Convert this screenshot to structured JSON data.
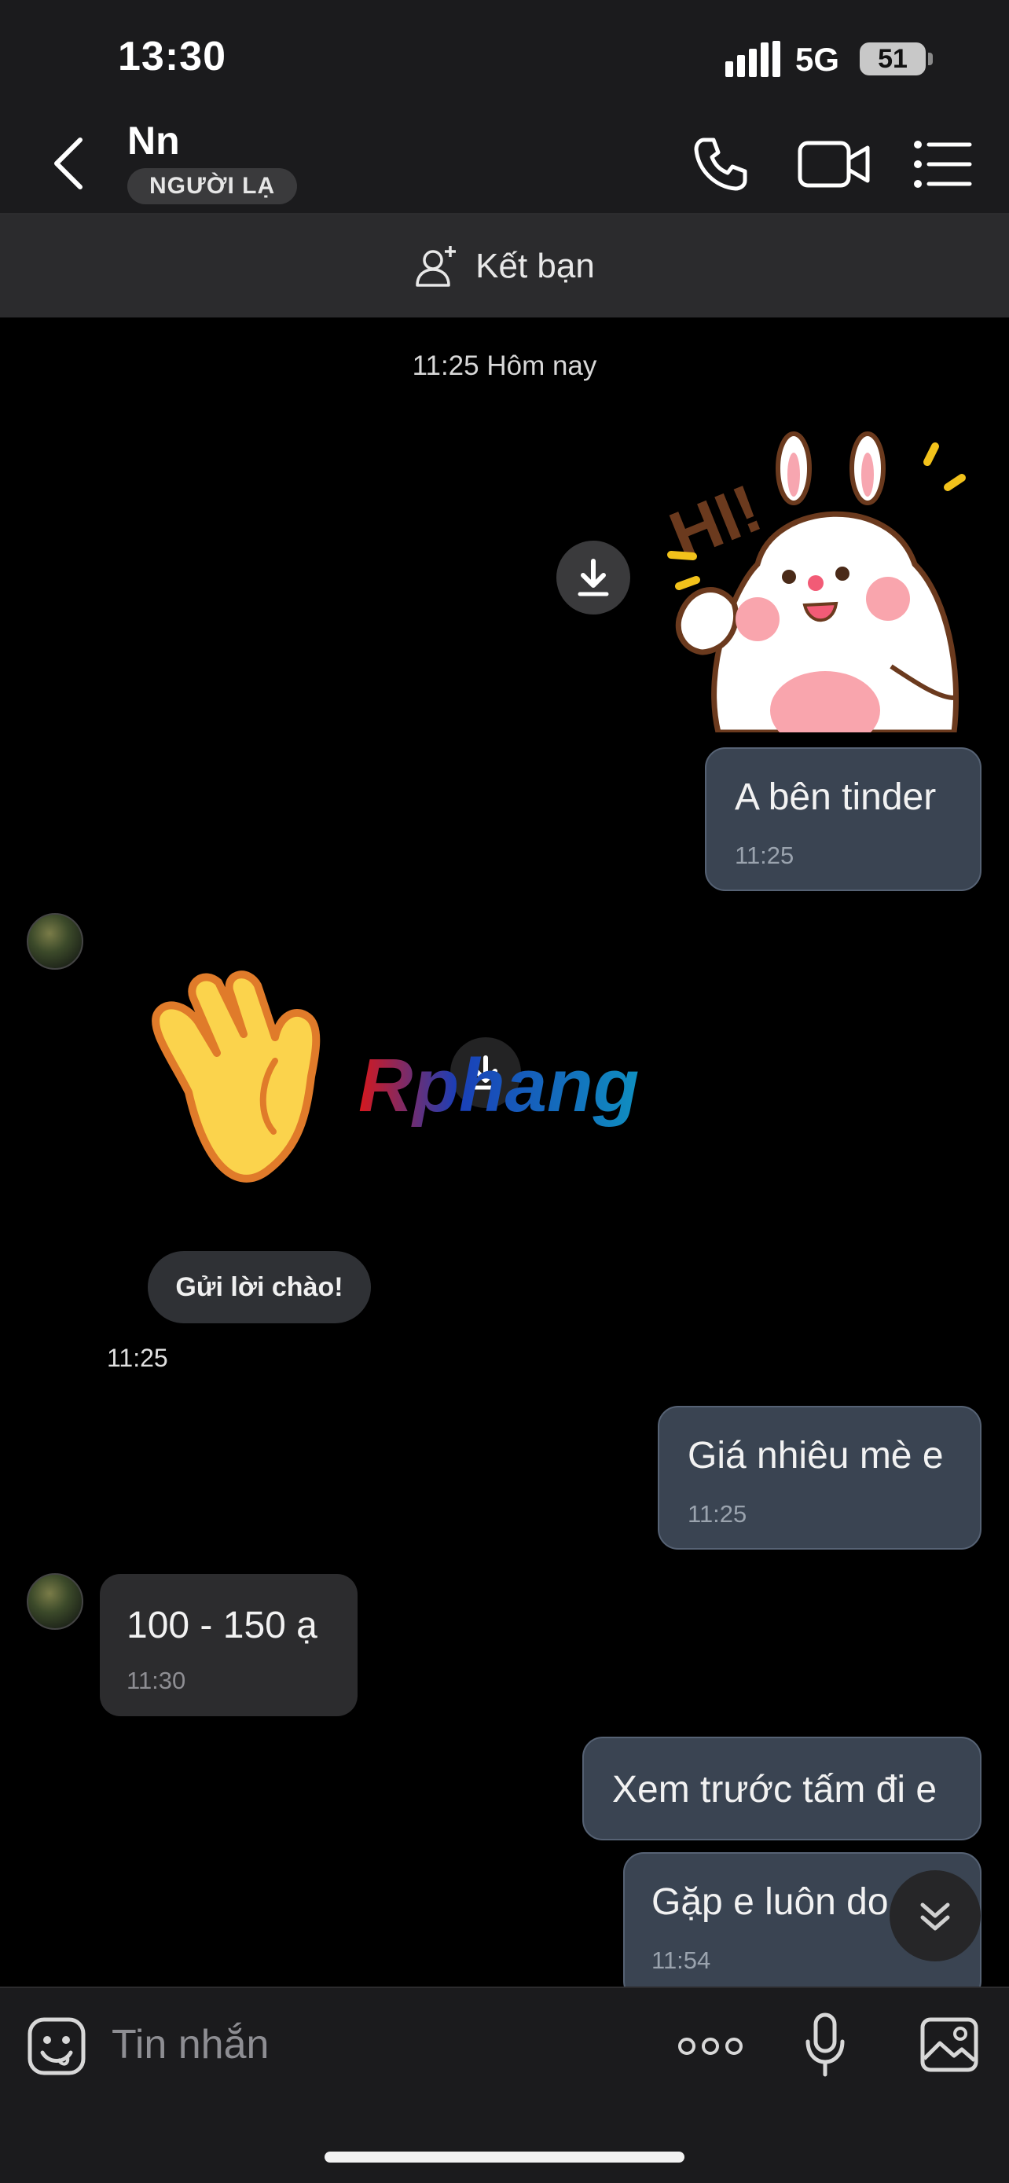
{
  "status_bar": {
    "time": "13:30",
    "network": "5G",
    "battery": "51"
  },
  "header": {
    "contact_name": "Nn",
    "badge": "NGƯỜI LẠ",
    "icons": [
      "back-chevron-icon",
      "phone-icon",
      "video-camera-icon",
      "menu-list-icon"
    ]
  },
  "friend_bar": {
    "label": "Kết bạn"
  },
  "chat": {
    "date_separator": "11:25 Hôm nay",
    "messages": [
      {
        "side": "out",
        "type": "sticker",
        "description": "bunny-hi-sticker"
      },
      {
        "side": "out",
        "type": "text",
        "text": "A bên tinder",
        "time": "11:25"
      },
      {
        "side": "in",
        "type": "sticker",
        "description": "waving-hand-sticker"
      },
      {
        "side": "in",
        "type": "quick_reply",
        "text": "Gửi lời chào!",
        "time": "11:25"
      },
      {
        "side": "out",
        "type": "text",
        "text": "Giá nhiêu mè e",
        "time": "11:25"
      },
      {
        "side": "in",
        "type": "text",
        "text": "100 - 150 ạ",
        "time": "11:30"
      },
      {
        "side": "out",
        "type": "text",
        "text": "Xem trước tấm đi e",
        "time": ""
      },
      {
        "side": "out",
        "type": "text",
        "text": "Gặp e luôn do",
        "time": "11:54"
      }
    ],
    "sticker_text": "HI!",
    "watermark": "Rphang"
  },
  "composer": {
    "placeholder": "Tin nhắn",
    "icons": [
      "emoji-icon",
      "more-dots-icon",
      "microphone-icon",
      "image-icon"
    ]
  },
  "colors": {
    "background": "#000000",
    "bar": "#1b1b1d",
    "outgoing_bubble": "#3a4452",
    "incoming_bubble": "#2c2c2e"
  }
}
